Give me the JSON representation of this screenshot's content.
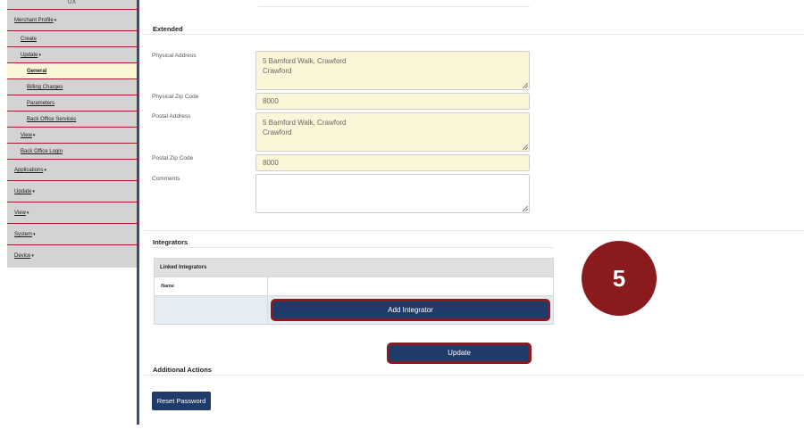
{
  "sidebar": {
    "top_label": "UX",
    "items": [
      {
        "label": "Merchant Profile",
        "caret": "▾",
        "level": 0
      },
      {
        "label": "Create",
        "caret": "",
        "level": 1
      },
      {
        "label": "Update",
        "caret": "▾",
        "level": 1
      },
      {
        "label": "General",
        "caret": "",
        "level": 2,
        "active": true
      },
      {
        "label": "Billing Charges",
        "caret": "",
        "level": 2
      },
      {
        "label": "Parameters",
        "caret": "",
        "level": 2
      },
      {
        "label": "Back Office Services",
        "caret": "",
        "level": 2
      },
      {
        "label": "View",
        "caret": "▾",
        "level": 1
      },
      {
        "label": "Back Office Login",
        "caret": "",
        "level": 1
      },
      {
        "label": "Applications",
        "caret": "▾",
        "level": 0
      },
      {
        "label": "Update",
        "caret": "▾",
        "level": 0
      },
      {
        "label": "View",
        "caret": "▾",
        "level": 0
      },
      {
        "label": "System",
        "caret": "▾",
        "level": 0
      },
      {
        "label": "Device",
        "caret": "▾",
        "level": 0
      }
    ]
  },
  "extended": {
    "title": "Extended",
    "physical_address_label": "Physical Address",
    "physical_address_line1": "5 Bamford Walk, Crawford",
    "physical_address_line2": "Crawford",
    "physical_zip_label": "Physical Zip Code",
    "physical_zip_value": "8000",
    "postal_address_label": "Postal Address",
    "postal_address_line1": "5 Bamford Walk, Crawford",
    "postal_address_line2": "Crawford",
    "postal_zip_label": "Postal Zip Code",
    "postal_zip_value": "8000",
    "comments_label": "Comments",
    "comments_value": ""
  },
  "integrators": {
    "title": "Integrators",
    "table_header": "Linked Integrators",
    "name_column": "Name",
    "add_button": "Add Integrator"
  },
  "update_button": "Update",
  "additional_actions": {
    "title": "Additional Actions",
    "reset_password_button": "Reset Password"
  },
  "step_badge": "5",
  "colors": {
    "accent_red": "#8b1a1f",
    "button_blue": "#1f3b6a",
    "input_yellow": "#fcf6d9",
    "sidebar_gray": "#d3d3d3"
  }
}
